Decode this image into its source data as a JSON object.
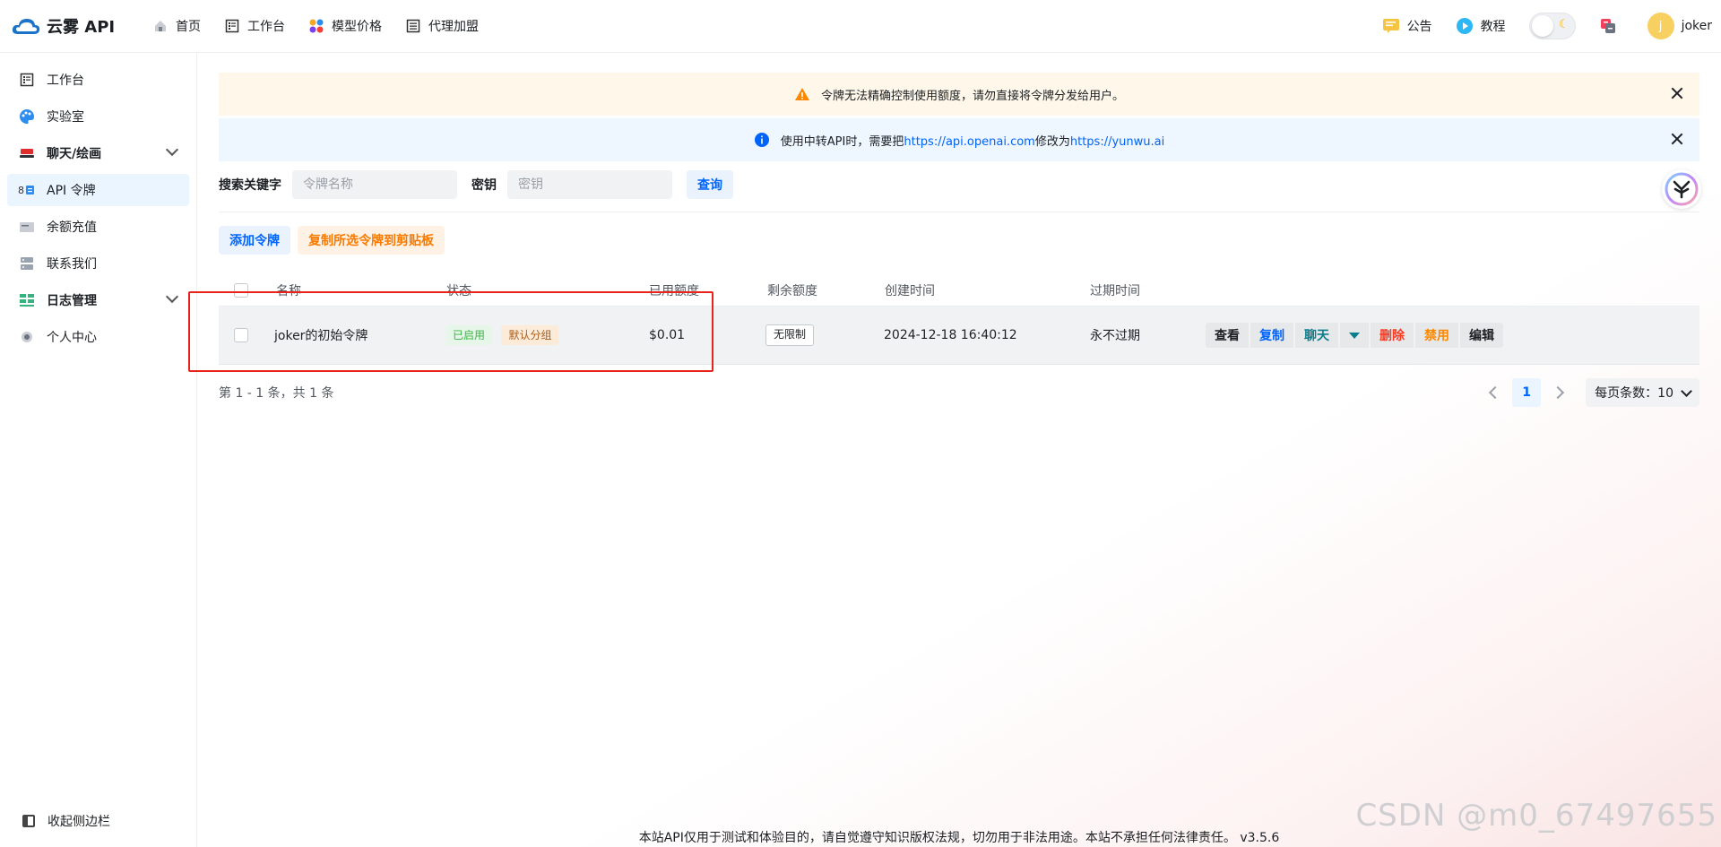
{
  "brand": {
    "name": "云雾 API"
  },
  "topnav": {
    "items": [
      {
        "label": "首页",
        "icon": "home-icon"
      },
      {
        "label": "工作台",
        "icon": "workbench-icon"
      },
      {
        "label": "模型价格",
        "icon": "price-icon"
      },
      {
        "label": "代理加盟",
        "icon": "agent-icon"
      }
    ],
    "announcement": "公告",
    "tutorial": "教程",
    "user": {
      "initial": "j",
      "name": "joker"
    }
  },
  "sidebar": {
    "items": [
      {
        "label": "工作台"
      },
      {
        "label": "实验室"
      },
      {
        "label": "聊天/绘画"
      },
      {
        "label": "API 令牌"
      },
      {
        "label": "余额充值"
      },
      {
        "label": "联系我们"
      },
      {
        "label": "日志管理"
      },
      {
        "label": "个人中心"
      }
    ],
    "collapse_label": "收起侧边栏"
  },
  "banners": {
    "warning": "令牌无法精确控制使用额度，请勿直接将令牌分发给用户。",
    "info_prefix": "使用中转API时，需要把",
    "info_link1": "https://api.openai.com",
    "info_mid": "修改为",
    "info_link2": "https://yunwu.ai"
  },
  "search": {
    "keyword_label": "搜索关键字",
    "keyword_placeholder": "令牌名称",
    "key_label": "密钥",
    "key_placeholder": "密钥",
    "query_button": "查询"
  },
  "actions": {
    "add_token": "添加令牌",
    "copy_selected": "复制所选令牌到剪贴板"
  },
  "table": {
    "headers": [
      "名称",
      "状态",
      "已用额度",
      "剩余额度",
      "创建时间",
      "过期时间"
    ],
    "rows": [
      {
        "name": "joker的初始令牌",
        "status": "已启用",
        "group": "默认分组",
        "used": "$0.01",
        "remaining": "无限制",
        "created": "2024-12-18 16:40:12",
        "expires": "永不过期",
        "ops": {
          "view": "查看",
          "copy": "复制",
          "chat": "聊天",
          "delete": "删除",
          "disable": "禁用",
          "edit": "编辑"
        }
      }
    ]
  },
  "pagination": {
    "summary": "第 1 - 1 条，共 1 条",
    "current_page": "1",
    "page_size": "每页条数：10"
  },
  "footer": "本站API仅用于测试和体验目的，请自觉遵守知识版权法规，切勿用于非法用途。本站不承担任何法律责任。 v3.5.6",
  "watermark": "CSDN @m0_67497655",
  "colors": {
    "accent": "#0064fa",
    "warning_bg": "#fff8ea",
    "info_bg": "#eef6ff",
    "danger": "#f93920",
    "highlight_box": "#e8231c"
  }
}
